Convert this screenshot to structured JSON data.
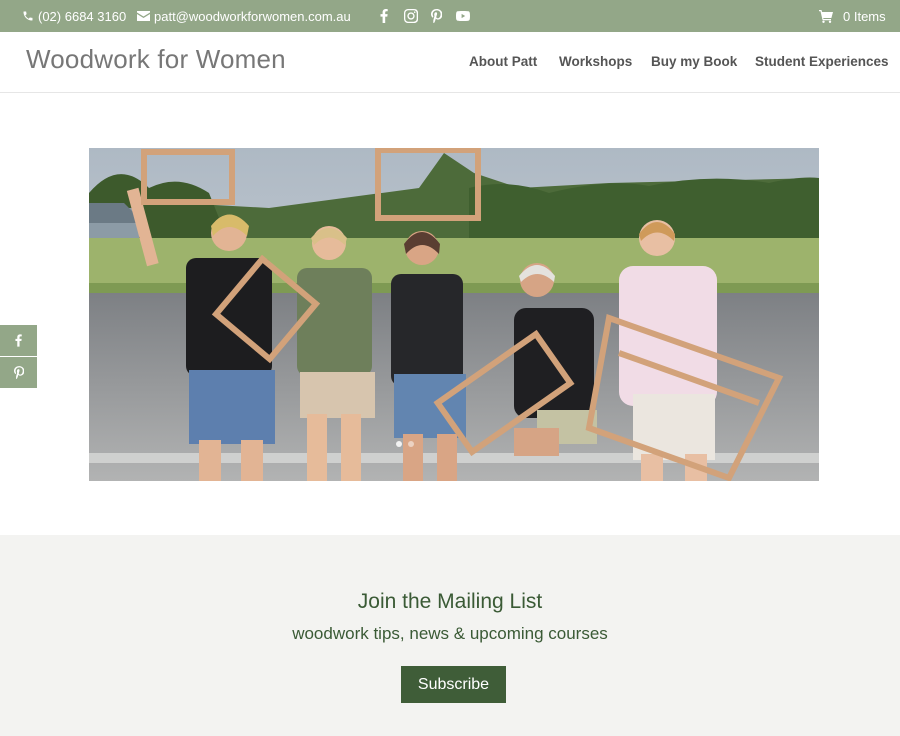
{
  "topbar": {
    "phone": "(02) 6684 3160",
    "email": "patt@woodworkforwomen.com.au",
    "social_icons": [
      "facebook-icon",
      "instagram-icon",
      "pinterest-icon",
      "youtube-icon"
    ],
    "cart_label": "0 Items"
  },
  "header": {
    "logo": "Woodwork for Women",
    "nav": [
      "About Patt",
      "Workshops",
      "Buy my Book",
      "Student Experiences"
    ]
  },
  "hero": {
    "description_icon": "photo"
  },
  "side_share": [
    "facebook-icon",
    "pinterest-icon"
  ],
  "mailing": {
    "title": "Join the Mailing List",
    "subtitle": "woodwork tips, news & upcoming courses",
    "button": "Subscribe"
  },
  "colors": {
    "topbar": "#93a788",
    "accent": "#3f5d38",
    "mailing_bg": "#f3f3f1"
  }
}
